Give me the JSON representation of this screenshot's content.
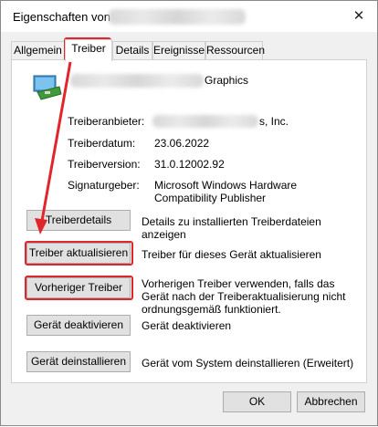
{
  "window": {
    "title": "Eigenschaften von",
    "close_glyph": "✕"
  },
  "tabs": [
    {
      "label": "Allgemein",
      "active": false
    },
    {
      "label": "Treiber",
      "active": true
    },
    {
      "label": "Details",
      "active": false
    },
    {
      "label": "Ereignisse",
      "active": false
    },
    {
      "label": "Ressourcen",
      "active": false
    }
  ],
  "device": {
    "icon": "display-adapter-icon",
    "name_visible_tail": "Graphics"
  },
  "properties": [
    {
      "label": "Treiberanbieter:",
      "value": "s, Inc."
    },
    {
      "label": "Treiberdatum:",
      "value": "23.06.2022"
    },
    {
      "label": "Treiberversion:",
      "value": "31.0.12002.92"
    },
    {
      "label": "Signaturgeber:",
      "value": "Microsoft Windows Hardware Compatibility Publisher"
    }
  ],
  "actions": [
    {
      "button": "Treiberdetails",
      "description": "Details zu installierten Treiberdateien anzeigen"
    },
    {
      "button": "Treiber aktualisieren",
      "description": "Treiber für dieses Gerät aktualisieren"
    },
    {
      "button": "Vorheriger Treiber",
      "description": "Vorherigen Treiber verwenden, falls das Gerät nach der Treiberaktualisierung nicht ordnungsgemäß funktioniert."
    },
    {
      "button": "Gerät deaktivieren",
      "description": "Gerät deaktivieren"
    },
    {
      "button": "Gerät deinstallieren",
      "description": "Gerät vom System deinstallieren (Erweitert)"
    }
  ],
  "footer": {
    "ok": "OK",
    "cancel": "Abbrechen"
  },
  "annotation_color": "#e0262b"
}
